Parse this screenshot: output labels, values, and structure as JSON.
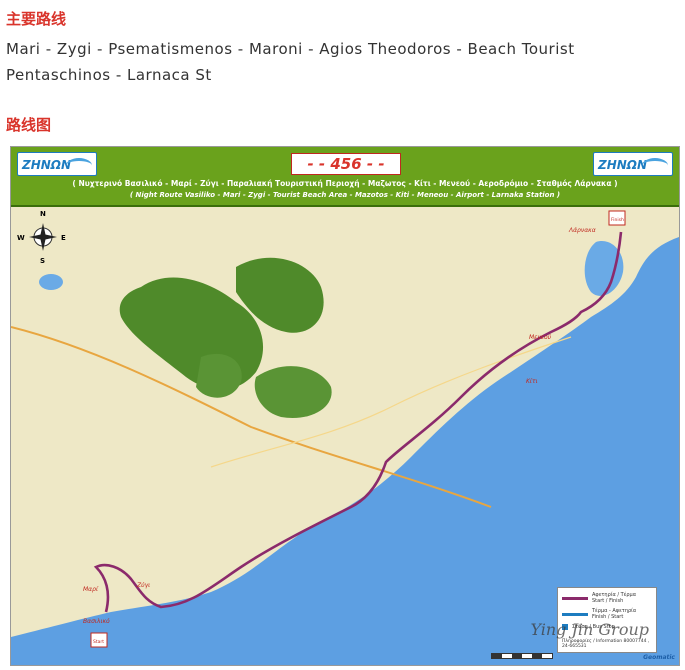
{
  "section_main_route": {
    "heading": "主要路线"
  },
  "route_description": {
    "line1": "Mari - Zygi - Psematismenos - Maroni - Agios Theodoros - Beach Tourist",
    "line2": "Pentaschinos - Larnaca St"
  },
  "section_route_map": {
    "heading": "路线图"
  },
  "map": {
    "logo_left": "ZHNΩN",
    "logo_right": "ZHNΩN",
    "route_number": "- - 456 - -",
    "header_greek": "( Νυχτερινό Βασιλικό - Μαρί - Ζύγι - Παραλιακή Τουριστική Περιοχή - Μαζωτος - Κίτι - Μενεού - Αεροδρόμιο - Σταθμός Λάρνακα )",
    "header_english": "( Night Route Vasiliko - Mari - Zygi - Tourist Beach Area - Mazotos - Kiti - Meneou - Airport - Larnaka Station )",
    "compass": {
      "n": "N",
      "s": "S",
      "e": "E",
      "w": "W"
    },
    "places": {
      "larnaca": "Λάρνακα",
      "meneou": "Μενεού",
      "kiti": "Κίτι",
      "mari": "Μαρί",
      "zygi": "Ζύγι",
      "vasiliko": "Βασιλικό",
      "finish": "Finish",
      "start": "Start"
    },
    "legend": {
      "row1_greek": "Αφετηρία / Τέρμα",
      "row1_en": "Start / Finish",
      "row2_greek": "Τέρμα - Αφετηρία",
      "row2_en": "Finish / Start",
      "row3_greek": "Στάση / Bus Stop",
      "info": "Πληροφορίες / Information 80007744 , 24-665531"
    },
    "watermark": "Ying Jin Group",
    "brand": "Geomatic",
    "colors": {
      "header_green": "#6aa21c",
      "route_purple": "#8b2a6b",
      "sea": "#5a9fe0",
      "land": "#efe8c8",
      "forest": "#4f8a2a"
    }
  }
}
